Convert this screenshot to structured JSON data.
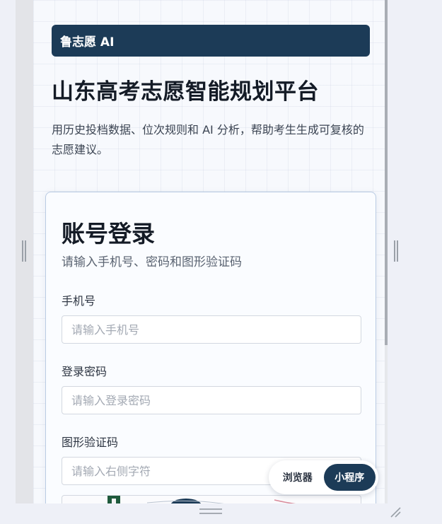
{
  "brand": {
    "label": "鲁志愿 AI"
  },
  "hero": {
    "title": "山东高考志愿智能规划平台",
    "description": "用历史投档数据、位次规则和 AI 分析，帮助考生生成可复核的志愿建议。"
  },
  "login": {
    "title": "账号登录",
    "subtitle": "请输入手机号、密码和图形验证码",
    "fields": [
      {
        "label": "手机号",
        "placeholder": "请输入手机号",
        "value": ""
      },
      {
        "label": "登录密码",
        "placeholder": "请输入登录密码",
        "value": ""
      },
      {
        "label": "图形验证码",
        "placeholder": "请输入右侧字符",
        "value": ""
      }
    ]
  },
  "mode_toggle": {
    "options": [
      {
        "label": "浏览器",
        "active": false
      },
      {
        "label": "小程序",
        "active": true
      }
    ]
  },
  "colors": {
    "brand": "#1c3b57",
    "title": "#141b26",
    "card_border": "#b9cbe3"
  }
}
